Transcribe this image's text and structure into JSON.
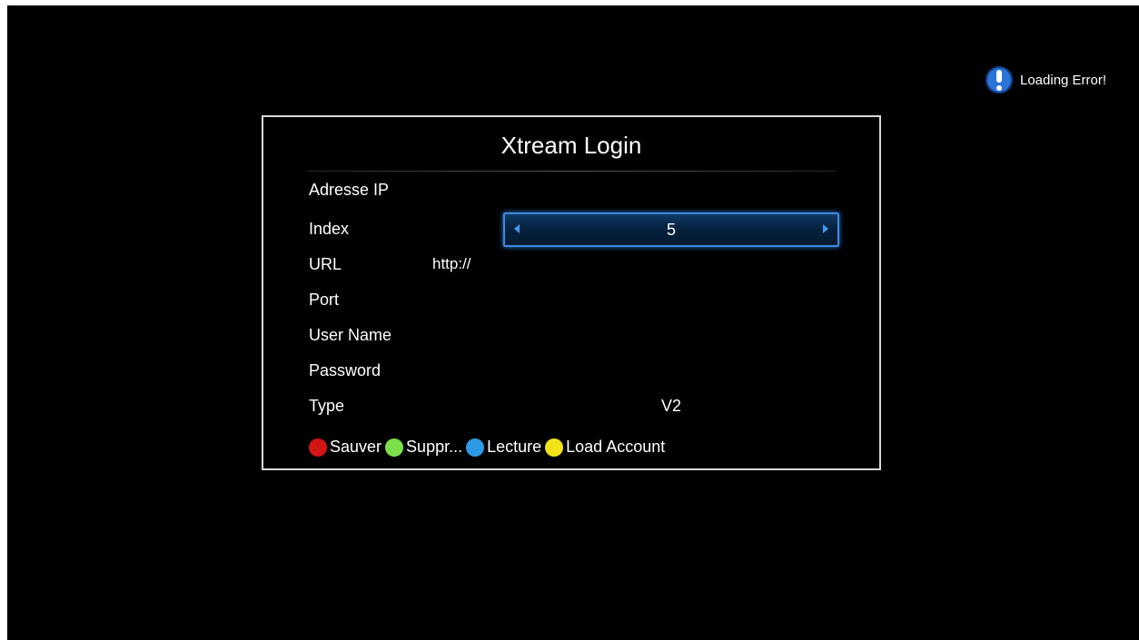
{
  "notification": {
    "text": "Loading Error!",
    "icon": "info-alert-icon",
    "color": "#2a74d6"
  },
  "dialog": {
    "title": "Xtream Login",
    "rows": {
      "ip_label": "Adresse IP",
      "index_label": "Index",
      "index_value": "5",
      "url_label": "URL",
      "url_value": "http://",
      "port_label": "Port",
      "username_label": "User Name",
      "password_label": "Password",
      "type_label": "Type",
      "type_value": "V2"
    }
  },
  "color_buttons": [
    {
      "label": "Sauver",
      "color": "#d41515"
    },
    {
      "label": "Suppr...",
      "color": "#7be04a"
    },
    {
      "label": "Lecture",
      "color": "#2e9ae6"
    },
    {
      "label": "Load Account",
      "color": "#f2e21a"
    }
  ]
}
